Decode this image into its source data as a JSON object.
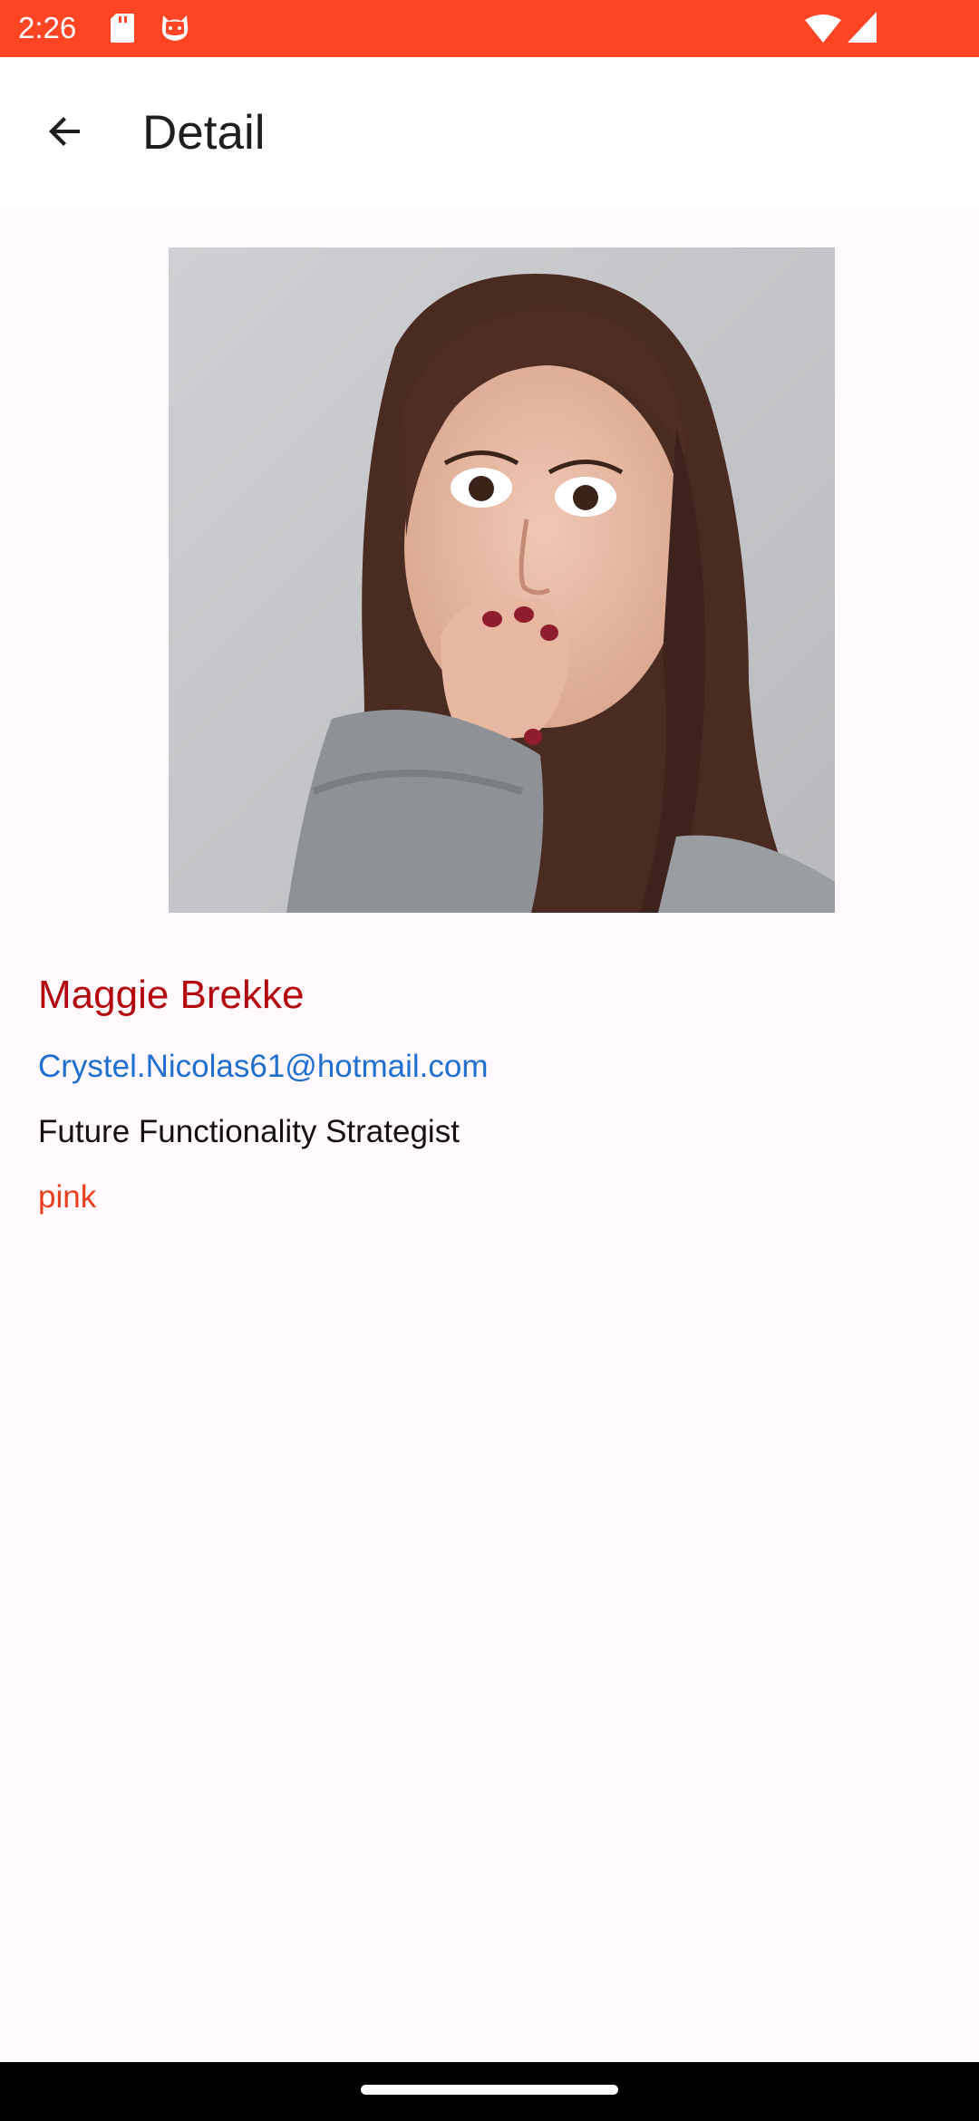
{
  "status_bar": {
    "time": "2:26",
    "background": "#ff4524",
    "icons": [
      "sd-card-icon",
      "cat-notification-icon",
      "wifi-icon",
      "signal-icon"
    ]
  },
  "app_bar": {
    "back_icon": "arrow-back-icon",
    "title": "Detail"
  },
  "profile": {
    "photo": "portrait of a surprised woman with hand over mouth",
    "name": "Maggie Brekke",
    "email": "Crystel.Nicolas61@hotmail.com",
    "job_title": "Future Functionality Strategist",
    "favorite_color": "pink"
  },
  "colors": {
    "name": "#b3080d",
    "email": "#1e6fd0",
    "job_title": "#121212",
    "favorite_color": "#e8401e",
    "page_background": "#fff8fc"
  },
  "nav_bar": {
    "home_indicator": "home-indicator"
  }
}
